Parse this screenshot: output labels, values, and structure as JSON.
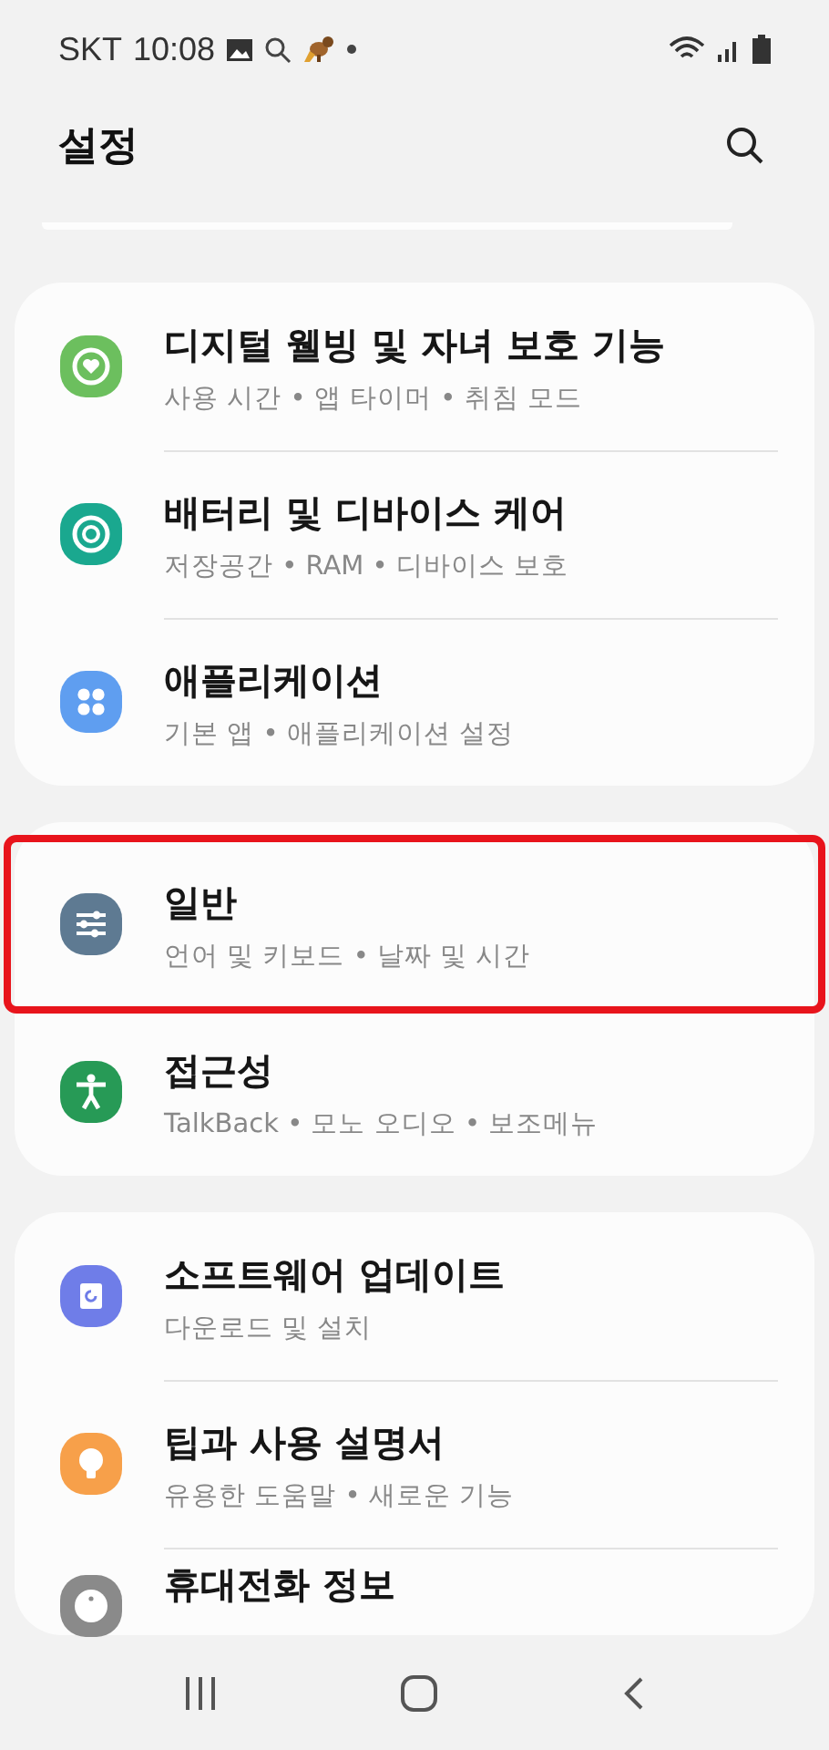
{
  "status_bar": {
    "carrier": "SKT",
    "time": "10:08"
  },
  "header": {
    "title": "설정"
  },
  "groups": [
    {
      "items": [
        {
          "kind": "wellbeing",
          "title": "디지털 웰빙 및 자녀 보호 기능",
          "subtitle": "사용 시간 • 앱 타이머 • 취침 모드",
          "highlighted": false
        },
        {
          "kind": "device-care",
          "title": "배터리 및 디바이스 케어",
          "subtitle": "저장공간 • RAM • 디바이스 보호",
          "highlighted": false
        },
        {
          "kind": "apps",
          "title": "애플리케이션",
          "subtitle": "기본 앱 • 애플리케이션 설정",
          "highlighted": false
        }
      ]
    },
    {
      "items": [
        {
          "kind": "general",
          "title": "일반",
          "subtitle": "언어 및 키보드 • 날짜 및 시간",
          "highlighted": true
        },
        {
          "kind": "accessibility",
          "title": "접근성",
          "subtitle": "TalkBack • 모노 오디오 • 보조메뉴",
          "highlighted": false
        }
      ]
    },
    {
      "items": [
        {
          "kind": "update",
          "title": "소프트웨어 업데이트",
          "subtitle": "다운로드 및 설치",
          "highlighted": false
        },
        {
          "kind": "tips",
          "title": "팁과 사용 설명서",
          "subtitle": "유용한 도움말 • 새로운 기능",
          "highlighted": false
        },
        {
          "kind": "about",
          "title": "휴대전화 정보",
          "highlighted": false
        }
      ]
    }
  ]
}
